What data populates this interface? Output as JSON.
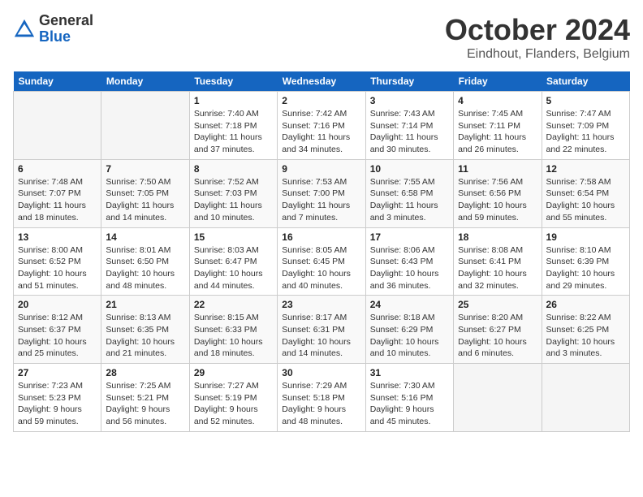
{
  "header": {
    "logo_general": "General",
    "logo_blue": "Blue",
    "month_title": "October 2024",
    "location": "Eindhout, Flanders, Belgium"
  },
  "weekdays": [
    "Sunday",
    "Monday",
    "Tuesday",
    "Wednesday",
    "Thursday",
    "Friday",
    "Saturday"
  ],
  "weeks": [
    [
      {
        "day": "",
        "info": ""
      },
      {
        "day": "",
        "info": ""
      },
      {
        "day": "1",
        "info": "Sunrise: 7:40 AM\nSunset: 7:18 PM\nDaylight: 11 hours\nand 37 minutes."
      },
      {
        "day": "2",
        "info": "Sunrise: 7:42 AM\nSunset: 7:16 PM\nDaylight: 11 hours\nand 34 minutes."
      },
      {
        "day": "3",
        "info": "Sunrise: 7:43 AM\nSunset: 7:14 PM\nDaylight: 11 hours\nand 30 minutes."
      },
      {
        "day": "4",
        "info": "Sunrise: 7:45 AM\nSunset: 7:11 PM\nDaylight: 11 hours\nand 26 minutes."
      },
      {
        "day": "5",
        "info": "Sunrise: 7:47 AM\nSunset: 7:09 PM\nDaylight: 11 hours\nand 22 minutes."
      }
    ],
    [
      {
        "day": "6",
        "info": "Sunrise: 7:48 AM\nSunset: 7:07 PM\nDaylight: 11 hours\nand 18 minutes."
      },
      {
        "day": "7",
        "info": "Sunrise: 7:50 AM\nSunset: 7:05 PM\nDaylight: 11 hours\nand 14 minutes."
      },
      {
        "day": "8",
        "info": "Sunrise: 7:52 AM\nSunset: 7:03 PM\nDaylight: 11 hours\nand 10 minutes."
      },
      {
        "day": "9",
        "info": "Sunrise: 7:53 AM\nSunset: 7:00 PM\nDaylight: 11 hours\nand 7 minutes."
      },
      {
        "day": "10",
        "info": "Sunrise: 7:55 AM\nSunset: 6:58 PM\nDaylight: 11 hours\nand 3 minutes."
      },
      {
        "day": "11",
        "info": "Sunrise: 7:56 AM\nSunset: 6:56 PM\nDaylight: 10 hours\nand 59 minutes."
      },
      {
        "day": "12",
        "info": "Sunrise: 7:58 AM\nSunset: 6:54 PM\nDaylight: 10 hours\nand 55 minutes."
      }
    ],
    [
      {
        "day": "13",
        "info": "Sunrise: 8:00 AM\nSunset: 6:52 PM\nDaylight: 10 hours\nand 51 minutes."
      },
      {
        "day": "14",
        "info": "Sunrise: 8:01 AM\nSunset: 6:50 PM\nDaylight: 10 hours\nand 48 minutes."
      },
      {
        "day": "15",
        "info": "Sunrise: 8:03 AM\nSunset: 6:47 PM\nDaylight: 10 hours\nand 44 minutes."
      },
      {
        "day": "16",
        "info": "Sunrise: 8:05 AM\nSunset: 6:45 PM\nDaylight: 10 hours\nand 40 minutes."
      },
      {
        "day": "17",
        "info": "Sunrise: 8:06 AM\nSunset: 6:43 PM\nDaylight: 10 hours\nand 36 minutes."
      },
      {
        "day": "18",
        "info": "Sunrise: 8:08 AM\nSunset: 6:41 PM\nDaylight: 10 hours\nand 32 minutes."
      },
      {
        "day": "19",
        "info": "Sunrise: 8:10 AM\nSunset: 6:39 PM\nDaylight: 10 hours\nand 29 minutes."
      }
    ],
    [
      {
        "day": "20",
        "info": "Sunrise: 8:12 AM\nSunset: 6:37 PM\nDaylight: 10 hours\nand 25 minutes."
      },
      {
        "day": "21",
        "info": "Sunrise: 8:13 AM\nSunset: 6:35 PM\nDaylight: 10 hours\nand 21 minutes."
      },
      {
        "day": "22",
        "info": "Sunrise: 8:15 AM\nSunset: 6:33 PM\nDaylight: 10 hours\nand 18 minutes."
      },
      {
        "day": "23",
        "info": "Sunrise: 8:17 AM\nSunset: 6:31 PM\nDaylight: 10 hours\nand 14 minutes."
      },
      {
        "day": "24",
        "info": "Sunrise: 8:18 AM\nSunset: 6:29 PM\nDaylight: 10 hours\nand 10 minutes."
      },
      {
        "day": "25",
        "info": "Sunrise: 8:20 AM\nSunset: 6:27 PM\nDaylight: 10 hours\nand 6 minutes."
      },
      {
        "day": "26",
        "info": "Sunrise: 8:22 AM\nSunset: 6:25 PM\nDaylight: 10 hours\nand 3 minutes."
      }
    ],
    [
      {
        "day": "27",
        "info": "Sunrise: 7:23 AM\nSunset: 5:23 PM\nDaylight: 9 hours\nand 59 minutes."
      },
      {
        "day": "28",
        "info": "Sunrise: 7:25 AM\nSunset: 5:21 PM\nDaylight: 9 hours\nand 56 minutes."
      },
      {
        "day": "29",
        "info": "Sunrise: 7:27 AM\nSunset: 5:19 PM\nDaylight: 9 hours\nand 52 minutes."
      },
      {
        "day": "30",
        "info": "Sunrise: 7:29 AM\nSunset: 5:18 PM\nDaylight: 9 hours\nand 48 minutes."
      },
      {
        "day": "31",
        "info": "Sunrise: 7:30 AM\nSunset: 5:16 PM\nDaylight: 9 hours\nand 45 minutes."
      },
      {
        "day": "",
        "info": ""
      },
      {
        "day": "",
        "info": ""
      }
    ]
  ]
}
